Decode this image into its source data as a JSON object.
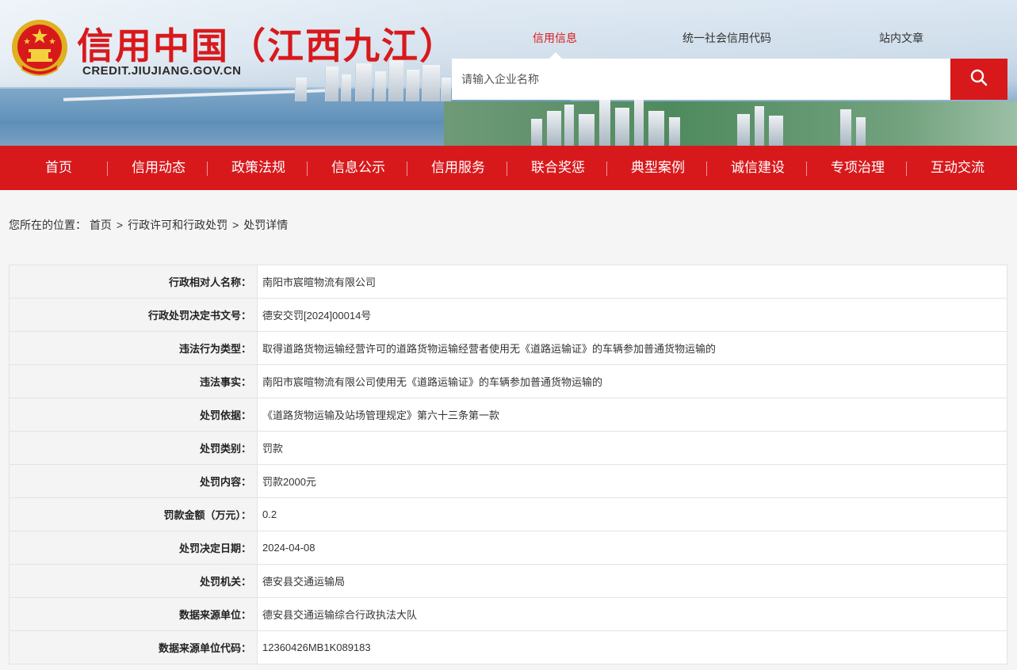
{
  "header": {
    "site_title": "信用中国（江西九江）",
    "site_domain": "CREDIT.JIUJIANG.GOV.CN",
    "logo": "national-emblem-icon",
    "search_tabs": [
      {
        "label": "信用信息",
        "active": true
      },
      {
        "label": "统一社会信用代码",
        "active": false
      },
      {
        "label": "站内文章",
        "active": false
      }
    ],
    "search_placeholder": "请输入企业名称",
    "search_icon": "search-icon"
  },
  "nav": {
    "items": [
      "首页",
      "信用动态",
      "政策法规",
      "信息公示",
      "信用服务",
      "联合奖惩",
      "典型案例",
      "诚信建设",
      "专项治理",
      "互动交流"
    ]
  },
  "breadcrumb": {
    "prefix": "您所在的位置：",
    "items": [
      "首页",
      "行政许可和行政处罚",
      "处罚详情"
    ],
    "separator": ">"
  },
  "detail": {
    "rows": [
      {
        "label": "行政相对人名称：",
        "value": "南阳市宸暄物流有限公司"
      },
      {
        "label": "行政处罚决定书文号：",
        "value": "德安交罚[2024]00014号"
      },
      {
        "label": "违法行为类型：",
        "value": "取得道路货物运输经营许可的道路货物运输经营者使用无《道路运输证》的车辆参加普通货物运输的"
      },
      {
        "label": "违法事实：",
        "value": "南阳市宸暄物流有限公司使用无《道路运输证》的车辆参加普通货物运输的"
      },
      {
        "label": "处罚依据：",
        "value": "《道路货物运输及站场管理规定》第六十三条第一款"
      },
      {
        "label": "处罚类别：",
        "value": "罚款"
      },
      {
        "label": "处罚内容：",
        "value": "罚款2000元"
      },
      {
        "label": "罚款金额（万元）：",
        "value": "0.2"
      },
      {
        "label": "处罚决定日期：",
        "value": "2024-04-08"
      },
      {
        "label": "处罚机关：",
        "value": "德安县交通运输局"
      },
      {
        "label": "数据来源单位：",
        "value": "德安县交通运输综合行政执法大队"
      },
      {
        "label": "数据来源单位代码：",
        "value": "12360426MB1K089183"
      }
    ]
  },
  "colors": {
    "brand_red": "#d8191c",
    "label_bg": "#f4f4f4",
    "border": "#e3e3e3"
  }
}
